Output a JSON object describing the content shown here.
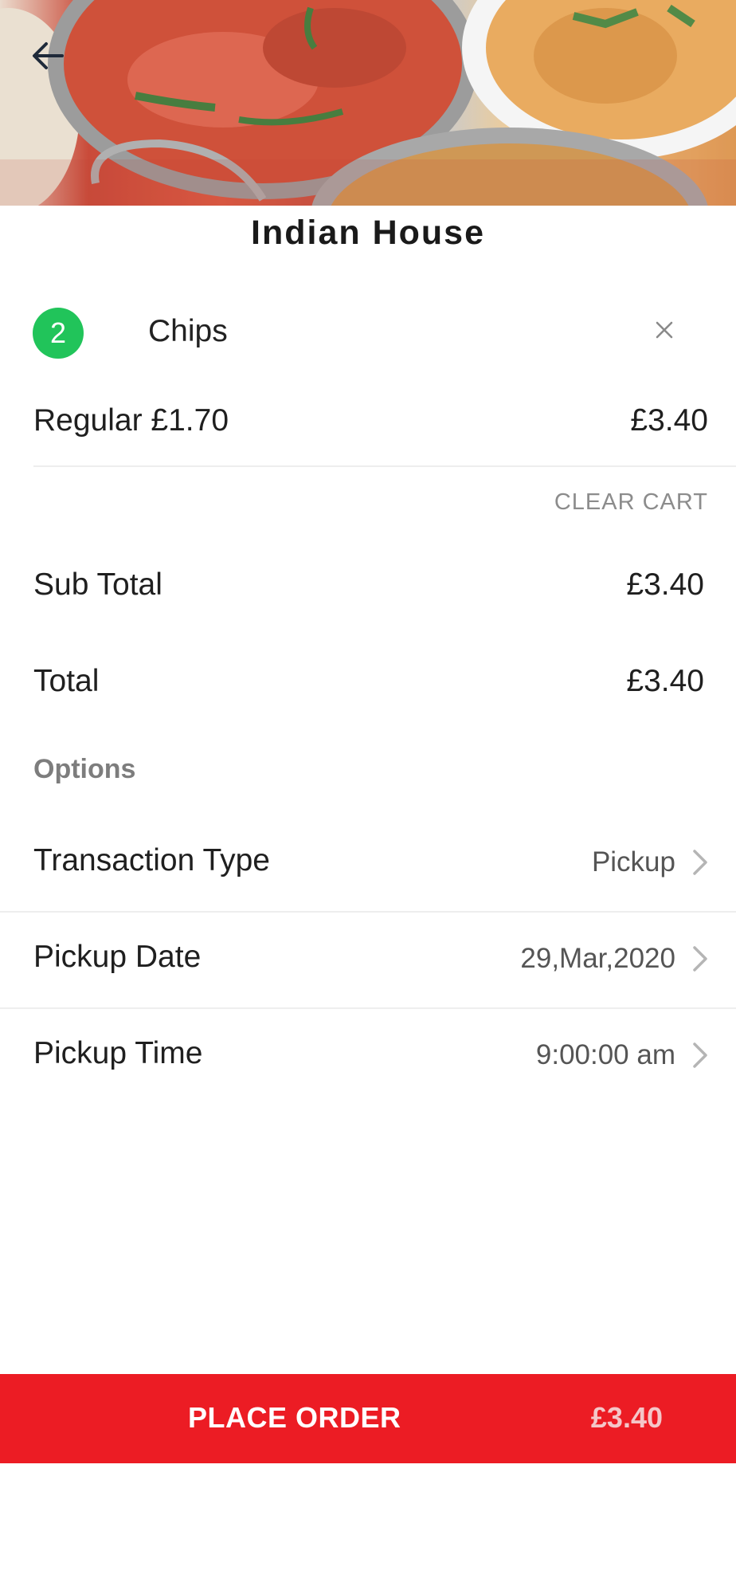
{
  "header": {
    "back_icon": "arrow-left-icon",
    "restaurant_name": "Indian House"
  },
  "cart": {
    "items": [
      {
        "quantity": "2",
        "name": "Chips",
        "variant": "Regular £1.70",
        "line_total": "£3.40",
        "remove_icon": "close-icon"
      }
    ],
    "clear_cart_label": "CLEAR CART"
  },
  "totals": {
    "subtotal_label": "Sub Total",
    "subtotal_value": "£3.40",
    "total_label": "Total",
    "total_value": "£3.40"
  },
  "options": {
    "section_title": "Options",
    "rows": [
      {
        "label": "Transaction Type",
        "value": "Pickup",
        "icon": "chevron-right-icon"
      },
      {
        "label": "Pickup Date",
        "value": "29,Mar,2020",
        "icon": "chevron-right-icon"
      },
      {
        "label": "Pickup Time",
        "value": "9:00:00 am",
        "icon": "chevron-right-icon"
      }
    ]
  },
  "footer": {
    "place_order_label": "PLACE ORDER",
    "place_order_amount": "£3.40"
  },
  "colors": {
    "accent_red": "#ec1c24",
    "badge_green": "#21c45a"
  }
}
